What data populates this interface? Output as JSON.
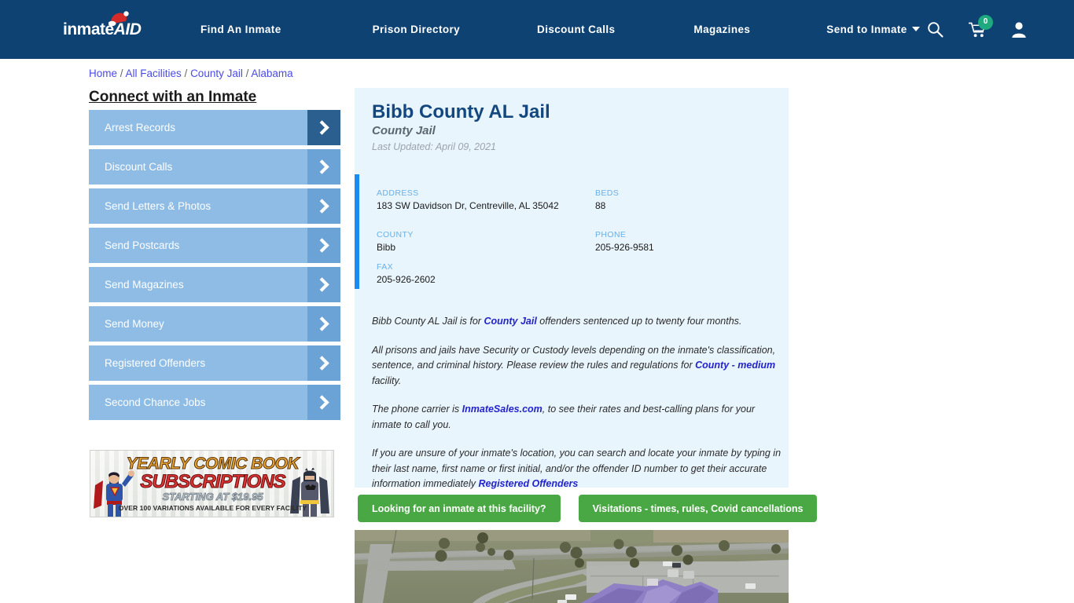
{
  "header": {
    "logo_text": "inmate",
    "logo_text_accent": "AID",
    "nav_items": [
      {
        "label": "Find An Inmate",
        "has_caret": false
      },
      {
        "label": "Prison Directory",
        "has_caret": false
      },
      {
        "label": "Discount Calls",
        "has_caret": false
      },
      {
        "label": "Magazines",
        "has_caret": false
      },
      {
        "label": "Send to Inmate",
        "has_caret": true
      }
    ],
    "icons": {
      "search": "search-icon",
      "cart": "shopping-cart-icon",
      "cart_count": "0",
      "account": "user-account-icon"
    },
    "colors": {
      "background": "#0d4273",
      "badge": "#1fa97f"
    }
  },
  "breadcrumb": {
    "items": [
      "Home",
      "All Facilities",
      "County Jail",
      "Alabama"
    ],
    "separator": "/"
  },
  "sidebar": {
    "title": "Connect with an Inmate",
    "items": [
      {
        "label": "Arrest Records",
        "active": true
      },
      {
        "label": "Discount Calls",
        "active": false
      },
      {
        "label": "Send Letters & Photos",
        "active": false
      },
      {
        "label": "Send Postcards",
        "active": false
      },
      {
        "label": "Send Magazines",
        "active": false
      },
      {
        "label": "Send Money",
        "active": false
      },
      {
        "label": "Registered Offenders",
        "active": false
      },
      {
        "label": "Second Chance Jobs",
        "active": false
      }
    ]
  },
  "ad": {
    "line1": "YEARLY COMIC BOOK",
    "line2": "SUBSCRIPTIONS",
    "line3": "STARTING AT $19.95",
    "line4": "OVER 100 VARIATIONS AVAILABLE FOR EVERY FACILITY"
  },
  "facility": {
    "name": "Bibb County AL Jail",
    "type": "County Jail",
    "last_updated": "Last Updated: April 09, 2021",
    "info": {
      "address_label": "ADDRESS",
      "address_value": "183 SW Davidson Dr, Centreville, AL 35042",
      "beds_label": "BEDS",
      "beds_value": "88",
      "county_label": "COUNTY",
      "county_value": "Bibb",
      "phone_label": "PHONE",
      "phone_value": "205-926-9581",
      "fax_label": "FAX",
      "fax_value": "205-926-2602"
    }
  },
  "description": {
    "p1_a": "Bibb County AL Jail is for ",
    "p1_link": "County Jail",
    "p1_b": " offenders sentenced up to twenty four months.",
    "p2_a": "All prisons and jails have Security or Custody levels depending on the inmate's classification, sentence, and criminal history. Please review the rules and regulations for ",
    "p2_link": "County - medium",
    "p2_b": " facility.",
    "p3_a": "The phone carrier is ",
    "p3_link": "InmateSales.com",
    "p3_b": ", to see their rates and best-calling plans for your inmate to call you.",
    "p4_a": "If you are unsure of your inmate's location, you can search and locate your inmate by typing in their last name, first name or first initial, and/or the offender ID number to get their accurate information immediately ",
    "p4_link": "Registered Offenders"
  },
  "actions": {
    "find_inmate_label": "Looking for an inmate at this facility?",
    "visitations_label": "Visitations - times, rules, Covid cancellations",
    "button_color": "#49a844"
  },
  "map": {
    "alt": "Aerial satellite view of Bibb County AL Jail facility"
  }
}
